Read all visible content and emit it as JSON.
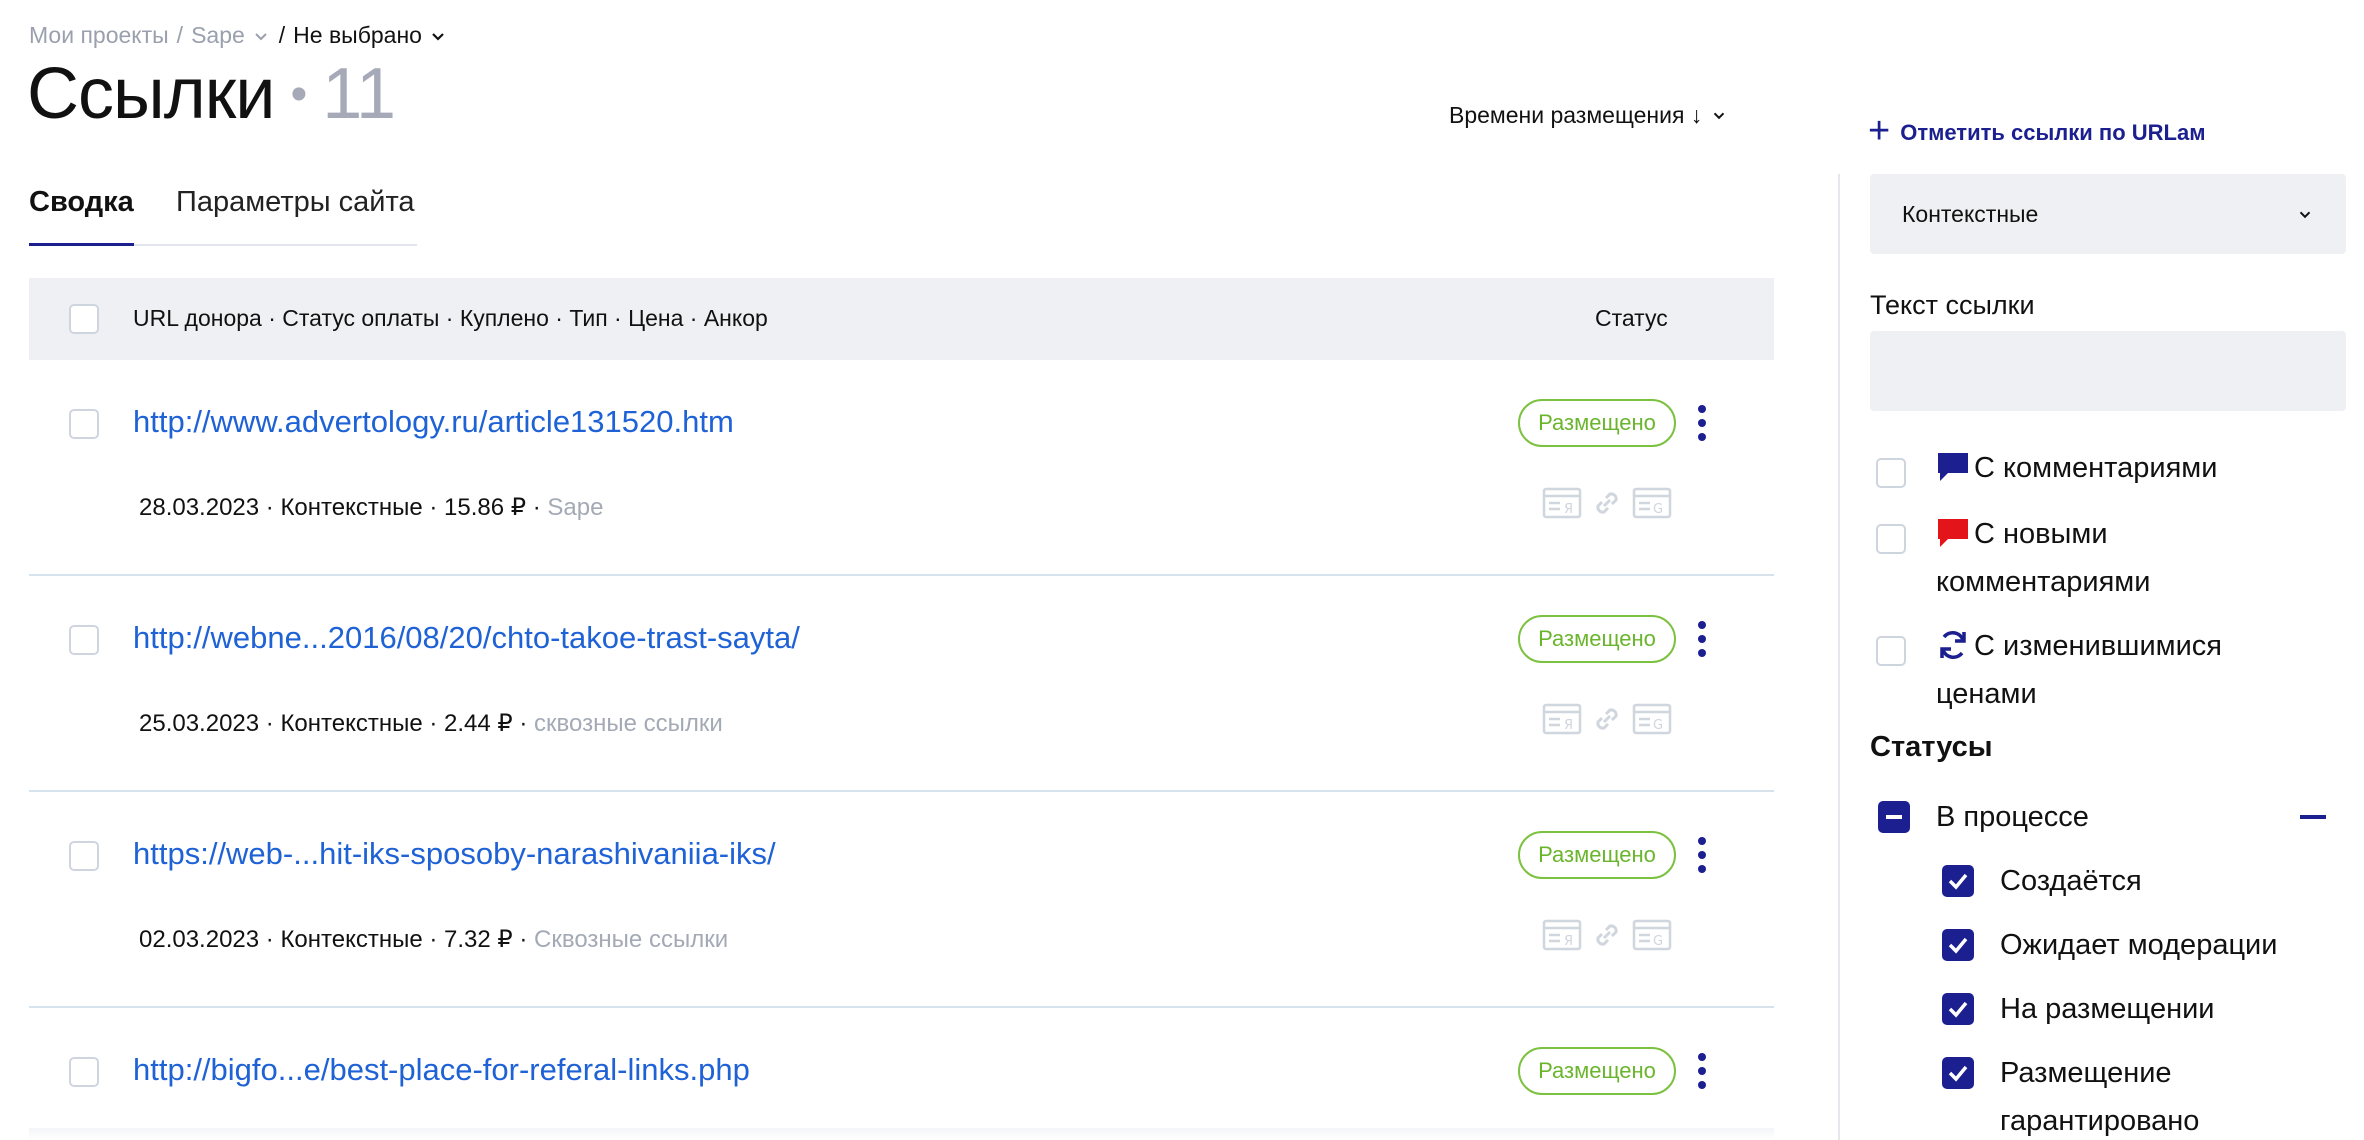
{
  "breadcrumb": {
    "root": "Мои проекты",
    "separator": "/",
    "project": "Sape",
    "current": "Не выбрано"
  },
  "page": {
    "title": "Ссылки",
    "dot": "•",
    "count": "11"
  },
  "sort": {
    "label": "Времени размещения ↓"
  },
  "tabs": [
    {
      "label": "Сводка",
      "active": true
    },
    {
      "label": "Параметры сайта",
      "active": false
    }
  ],
  "table": {
    "columns_label": "URL донора · Статус оплаты · Куплено · Тип · Цена · Анкор",
    "status_label": "Статус",
    "rows": [
      {
        "url": "http://www.advertology.ru/article131520.htm",
        "meta": "28.03.2023 · Контекстные · 15.86 ₽ ·",
        "anchor": "Sape",
        "status": "Размещено"
      },
      {
        "url": "http://webne...2016/08/20/chto-takoe-trast-sayta/",
        "meta": "25.03.2023 · Контекстные · 2.44 ₽ ·",
        "anchor": "сквозные ссылки",
        "status": "Размещено"
      },
      {
        "url": "https://web-...hit-iks-sposoby-narashivaniia-iks/",
        "meta": "02.03.2023 · Контекстные · 7.32 ₽ ·",
        "anchor": "Сквозные ссылки",
        "status": "Размещено"
      },
      {
        "url": "http://bigfo...e/best-place-for-referal-links.php",
        "meta": "",
        "anchor": "",
        "status": "Размещено"
      }
    ]
  },
  "sidebar": {
    "mark_urls_label": "Отметить ссылки по URLам",
    "type_select_value": "Контекстные",
    "link_text_label": "Текст ссылки",
    "link_text_value": "",
    "filters": [
      {
        "label": "С комментариями",
        "icon": "comment-icon"
      },
      {
        "label": "С новыми комментариями",
        "icon": "new-comment-icon"
      },
      {
        "label": "С изменившимися ценами",
        "icon": "refresh-icon"
      }
    ],
    "statuses_heading": "Статусы",
    "status_group": {
      "label": "В процессе",
      "children": [
        {
          "label": "Создаётся",
          "checked": true
        },
        {
          "label": "Ожидает модерации",
          "checked": true
        },
        {
          "label": "На размещении",
          "checked": true
        },
        {
          "label": "Размещение гарантировано",
          "checked": true
        }
      ]
    }
  },
  "colors": {
    "accent": "#1b1f8f",
    "link": "#1e62d6",
    "status_placed": "#6bb52d",
    "new_comment": "#e3141a",
    "muted": "#a4aab5"
  }
}
